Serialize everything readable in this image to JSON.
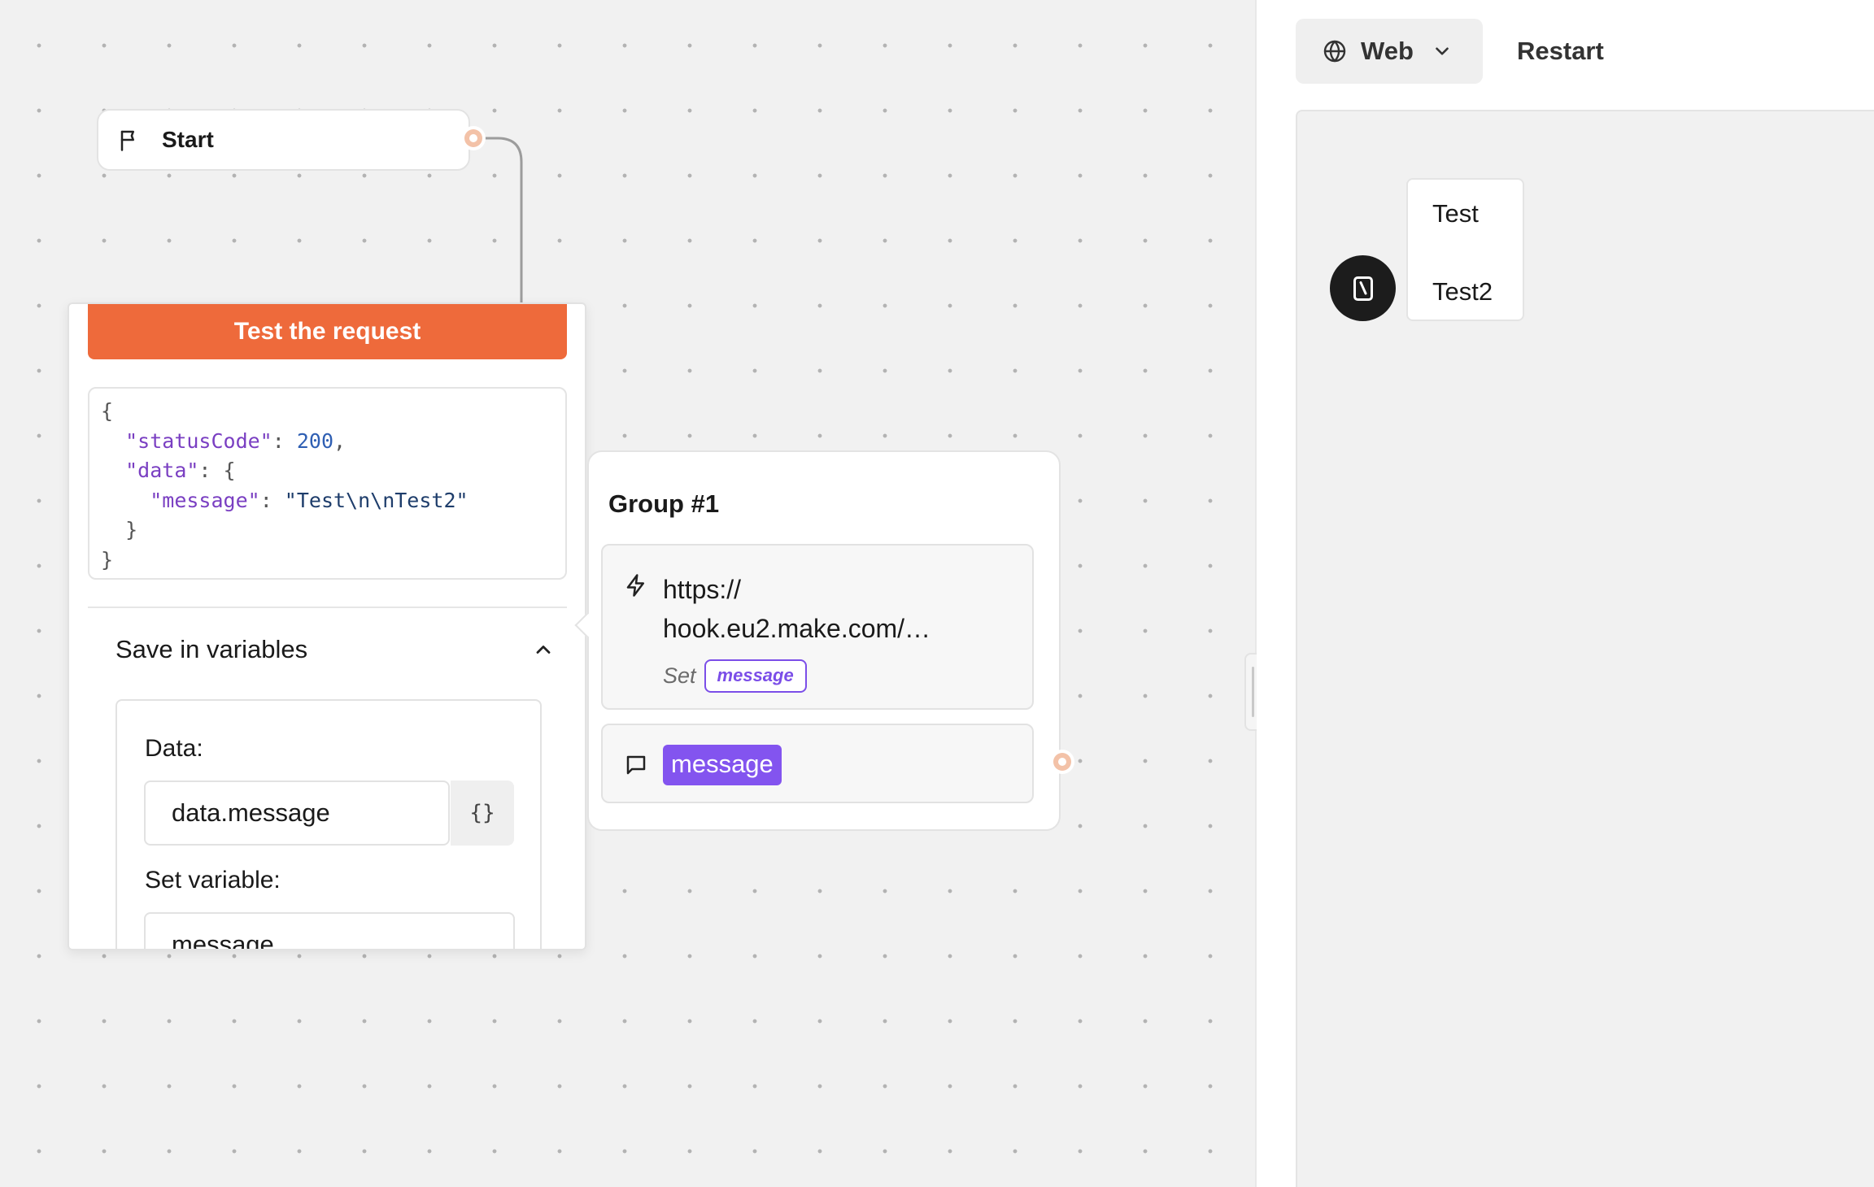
{
  "flow": {
    "start_node": {
      "label": "Start",
      "icon": "flag-icon"
    },
    "webhook_settings": {
      "test_button_label": "Test the request",
      "response_lines": [
        [
          {
            "t": "pun",
            "v": "{"
          }
        ],
        [
          {
            "t": "pun",
            "v": "  "
          },
          {
            "t": "key",
            "v": "\"statusCode\""
          },
          {
            "t": "pun",
            "v": ": "
          },
          {
            "t": "num",
            "v": "200"
          },
          {
            "t": "pun",
            "v": ","
          }
        ],
        [
          {
            "t": "pun",
            "v": "  "
          },
          {
            "t": "key",
            "v": "\"data\""
          },
          {
            "t": "pun",
            "v": ": {"
          }
        ],
        [
          {
            "t": "pun",
            "v": "    "
          },
          {
            "t": "key",
            "v": "\"message\""
          },
          {
            "t": "pun",
            "v": ": "
          },
          {
            "t": "str",
            "v": "\"Test\\n\\nTest2\""
          }
        ],
        [
          {
            "t": "pun",
            "v": "  }"
          }
        ],
        [
          {
            "t": "pun",
            "v": "}"
          }
        ]
      ],
      "save_section_label": "Save in variables",
      "data_label": "Data:",
      "data_value": "data.message",
      "braces_label": "{}",
      "set_variable_label": "Set variable:",
      "set_variable_value": "message"
    },
    "group": {
      "title": "Group #1",
      "webhook_url_lines": [
        "https://",
        "hook.eu2.make.com/…"
      ],
      "set_label": "Set",
      "set_variable": "message",
      "text_block_variable": "message"
    },
    "colors": {
      "accent_orange": "#ee6a3b",
      "variable_purple": "#8354ef",
      "endpoint_peach": "#f3c2a8"
    }
  },
  "preview": {
    "runtime_label": "Web",
    "runtime_icon": "globe-icon",
    "restart_label": "Restart",
    "chat": {
      "lines": [
        "Test",
        "",
        "Test2"
      ]
    }
  }
}
